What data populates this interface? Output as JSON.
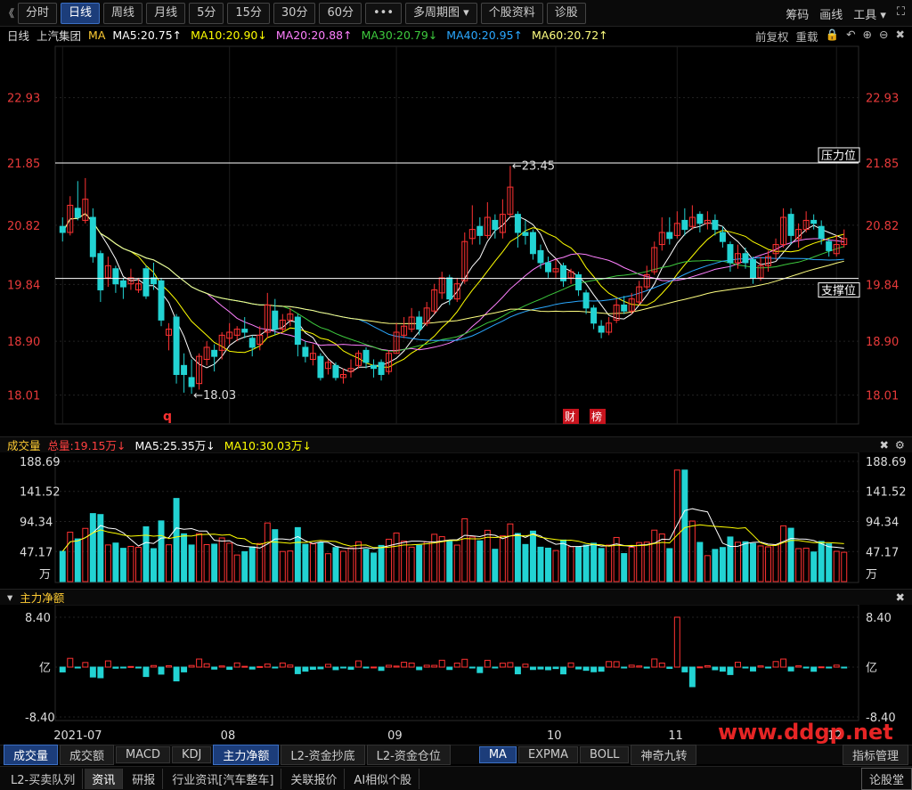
{
  "toolbar": {
    "back": "《",
    "tabs": [
      "分时",
      "日线",
      "周线",
      "月线",
      "5分",
      "15分",
      "30分",
      "60分",
      "•••",
      "多周期图 ▾",
      "个股资料",
      "诊股"
    ],
    "active": "日线",
    "right": [
      "筹码",
      "画线",
      "工具 ▾",
      "⛶"
    ]
  },
  "legend": {
    "period": "日线",
    "stock": "上汽集团",
    "ma": "MA",
    "items": [
      {
        "text": "MA5:20.75↑",
        "color": "#ffffff"
      },
      {
        "text": "MA10:20.90↓",
        "color": "#ffff00"
      },
      {
        "text": "MA20:20.88↑",
        "color": "#ff80ff"
      },
      {
        "text": "MA30:20.79↓",
        "color": "#3ecb3e"
      },
      {
        "text": "MA40:20.95↑",
        "color": "#2aa8ff"
      },
      {
        "text": "MA60:20.72↑",
        "color": "#ffff80"
      }
    ],
    "right": [
      "前复权",
      "重载"
    ]
  },
  "volume_legend": {
    "title": "成交量",
    "items": [
      {
        "text": "总量:19.15万↓",
        "color": "#ff4040"
      },
      {
        "text": "MA5:25.35万↓",
        "color": "#ffffff"
      },
      {
        "text": "MA10:30.03万↓",
        "color": "#ffff00"
      }
    ]
  },
  "netflow_legend": {
    "title": "主力净额"
  },
  "bottom_tabs": [
    "成交量",
    "成交额",
    "MACD",
    "KDJ",
    "主力净额",
    "L2-资金抄底",
    "L2-资金仓位",
    "MA",
    "EXPMA",
    "BOLL",
    "神奇九转",
    "指标管理"
  ],
  "bottom_active": [
    "成交量",
    "主力净额",
    "MA"
  ],
  "status_tabs": [
    "L2-买卖队列",
    "资讯",
    "研报",
    "行业资讯[汽车整车]",
    "关联报价",
    "AI相似个股",
    "论股堂"
  ],
  "status_active": "资讯",
  "watermark": "www.ddgp.net",
  "chart_data": {
    "type": "candlestick",
    "price_axis": {
      "labels": [
        "22.93",
        "21.85",
        "20.82",
        "19.84",
        "18.90",
        "18.01"
      ],
      "ylim": [
        17.65,
        23.75
      ]
    },
    "annotations": {
      "high": "23.45",
      "low": "18.03",
      "resistance": {
        "label": "压力位",
        "value": 21.85
      },
      "support": {
        "label": "支撑位",
        "value": 19.94
      },
      "markers": [
        "q",
        "财",
        "榜"
      ]
    },
    "x_labels": [
      {
        "label": "2021-07",
        "index": 0
      },
      {
        "label": "08",
        "index": 22
      },
      {
        "label": "09",
        "index": 44
      },
      {
        "label": "10",
        "index": 65
      },
      {
        "label": "11",
        "index": 81
      },
      {
        "label": "12",
        "index": 102
      }
    ],
    "candles": [
      [
        20.8,
        20.7,
        20.95,
        20.55
      ],
      [
        20.7,
        21.15,
        21.3,
        20.65
      ],
      [
        21.1,
        20.95,
        21.55,
        20.9
      ],
      [
        20.9,
        21.25,
        21.6,
        20.85
      ],
      [
        20.95,
        20.3,
        21.1,
        20.2
      ],
      [
        20.35,
        19.75,
        20.4,
        19.55
      ],
      [
        19.95,
        20.15,
        20.3,
        19.8
      ],
      [
        20.1,
        19.85,
        20.15,
        19.7
      ],
      [
        19.9,
        19.8,
        19.95,
        19.6
      ],
      [
        19.85,
        19.95,
        20.1,
        19.75
      ],
      [
        19.75,
        19.85,
        19.95,
        19.7
      ],
      [
        20.1,
        19.65,
        20.15,
        19.6
      ],
      [
        19.95,
        19.85,
        20.2,
        19.75
      ],
      [
        19.9,
        19.25,
        19.95,
        19.15
      ],
      [
        19.0,
        19.1,
        19.2,
        18.75
      ],
      [
        19.3,
        18.35,
        19.35,
        18.2
      ],
      [
        18.5,
        18.35,
        18.7,
        18.05
      ],
      [
        18.3,
        18.15,
        18.6,
        18.03
      ],
      [
        18.2,
        18.65,
        18.7,
        18.1
      ],
      [
        18.6,
        18.8,
        18.9,
        18.5
      ],
      [
        18.75,
        18.65,
        18.85,
        18.4
      ],
      [
        18.75,
        19.0,
        19.05,
        18.6
      ],
      [
        18.95,
        19.05,
        19.2,
        18.85
      ],
      [
        19.0,
        19.1,
        19.15,
        18.9
      ],
      [
        19.1,
        19.05,
        19.3,
        18.95
      ],
      [
        18.95,
        18.8,
        19.0,
        18.65
      ],
      [
        18.85,
        19.0,
        19.15,
        18.75
      ],
      [
        19.05,
        19.5,
        19.7,
        18.95
      ],
      [
        19.4,
        19.1,
        19.6,
        19.0
      ],
      [
        19.1,
        19.25,
        19.35,
        19.05
      ],
      [
        19.25,
        19.35,
        19.45,
        19.15
      ],
      [
        19.3,
        18.85,
        19.35,
        18.65
      ],
      [
        18.8,
        18.65,
        18.9,
        18.55
      ],
      [
        18.6,
        18.7,
        18.85,
        18.5
      ],
      [
        18.65,
        18.3,
        18.7,
        18.25
      ],
      [
        18.45,
        18.55,
        18.6,
        18.35
      ],
      [
        18.5,
        18.3,
        18.55,
        18.25
      ],
      [
        18.3,
        18.35,
        18.45,
        18.2
      ],
      [
        18.4,
        18.45,
        18.6,
        18.3
      ],
      [
        18.5,
        18.7,
        18.75,
        18.45
      ],
      [
        18.75,
        18.55,
        18.8,
        18.45
      ],
      [
        18.5,
        18.45,
        18.6,
        18.3
      ],
      [
        18.55,
        18.35,
        18.6,
        18.25
      ],
      [
        18.4,
        18.7,
        18.75,
        18.35
      ],
      [
        18.7,
        19.05,
        19.2,
        18.7
      ],
      [
        19.0,
        19.15,
        19.3,
        18.95
      ],
      [
        19.1,
        19.3,
        19.45,
        19.05
      ],
      [
        19.3,
        19.1,
        19.4,
        19.0
      ],
      [
        19.2,
        19.45,
        19.55,
        19.15
      ],
      [
        19.4,
        19.75,
        19.85,
        19.35
      ],
      [
        19.7,
        19.95,
        20.05,
        19.6
      ],
      [
        19.95,
        19.6,
        20.0,
        19.5
      ],
      [
        19.6,
        19.85,
        19.95,
        19.55
      ],
      [
        19.9,
        20.55,
        20.7,
        19.85
      ],
      [
        20.6,
        20.75,
        21.15,
        20.5
      ],
      [
        20.8,
        20.65,
        20.95,
        20.5
      ],
      [
        20.65,
        20.95,
        21.2,
        20.6
      ],
      [
        20.9,
        20.75,
        21.0,
        20.6
      ],
      [
        20.7,
        21.0,
        21.25,
        20.6
      ],
      [
        21.0,
        21.45,
        21.8,
        20.95
      ],
      [
        21.0,
        20.7,
        21.05,
        20.45
      ],
      [
        20.7,
        20.65,
        20.9,
        20.5
      ],
      [
        20.7,
        20.35,
        20.75,
        20.25
      ],
      [
        20.4,
        20.2,
        20.5,
        20.1
      ],
      [
        20.2,
        20.05,
        20.3,
        19.95
      ],
      [
        20.05,
        20.1,
        20.25,
        19.95
      ],
      [
        20.15,
        19.9,
        20.2,
        19.8
      ],
      [
        19.95,
        20.05,
        20.1,
        19.85
      ],
      [
        20.0,
        19.75,
        20.05,
        19.65
      ],
      [
        19.7,
        19.45,
        19.75,
        19.35
      ],
      [
        19.45,
        19.2,
        19.5,
        19.1
      ],
      [
        19.15,
        19.05,
        19.25,
        18.95
      ],
      [
        19.05,
        19.2,
        19.3,
        19.0
      ],
      [
        19.25,
        19.5,
        19.6,
        19.2
      ],
      [
        19.5,
        19.4,
        19.65,
        19.35
      ],
      [
        19.4,
        19.6,
        19.7,
        19.35
      ],
      [
        19.55,
        19.8,
        19.9,
        19.5
      ],
      [
        19.8,
        20.0,
        20.15,
        19.75
      ],
      [
        20.05,
        20.45,
        20.55,
        20.0
      ],
      [
        20.5,
        20.7,
        20.95,
        20.4
      ],
      [
        20.7,
        20.6,
        20.95,
        20.5
      ],
      [
        20.65,
        20.85,
        21.05,
        20.6
      ],
      [
        20.9,
        20.75,
        21.1,
        20.65
      ],
      [
        20.8,
        20.95,
        21.15,
        20.75
      ],
      [
        21.0,
        20.85,
        21.05,
        20.7
      ],
      [
        20.85,
        20.9,
        21.05,
        20.75
      ],
      [
        20.9,
        20.75,
        21.0,
        20.65
      ],
      [
        20.7,
        20.55,
        20.8,
        20.45
      ],
      [
        20.5,
        20.2,
        20.55,
        20.05
      ],
      [
        20.2,
        20.35,
        20.5,
        20.1
      ],
      [
        20.35,
        20.2,
        20.45,
        20.1
      ],
      [
        20.25,
        19.95,
        20.3,
        19.85
      ],
      [
        19.95,
        20.15,
        20.3,
        19.9
      ],
      [
        20.15,
        20.3,
        20.4,
        20.05
      ],
      [
        20.35,
        20.5,
        20.6,
        20.25
      ],
      [
        20.5,
        20.95,
        21.1,
        20.45
      ],
      [
        21.0,
        20.65,
        21.1,
        20.5
      ],
      [
        20.6,
        20.75,
        20.85,
        20.45
      ],
      [
        20.75,
        20.9,
        21.05,
        20.7
      ],
      [
        20.9,
        20.85,
        21.0,
        20.75
      ],
      [
        20.8,
        20.6,
        20.9,
        20.5
      ],
      [
        20.55,
        20.4,
        20.6,
        20.3
      ],
      [
        20.35,
        20.5,
        20.65,
        20.3
      ],
      [
        20.5,
        20.6,
        20.75,
        20.45
      ]
    ]
  }
}
